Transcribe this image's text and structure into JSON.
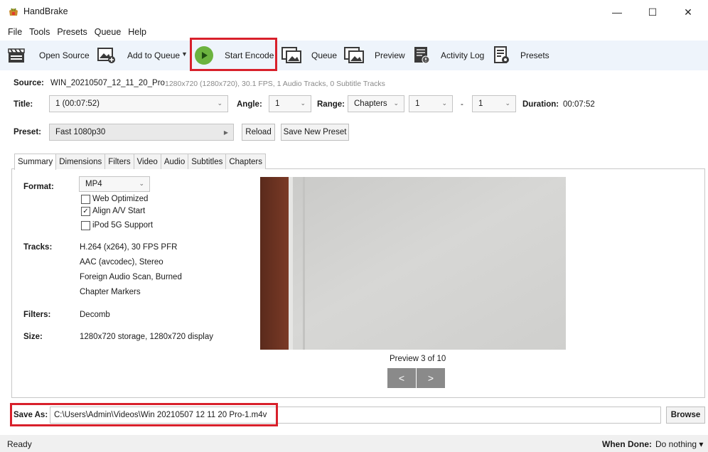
{
  "window": {
    "title": "HandBrake",
    "minimize": "—",
    "maximize": "☐",
    "close": "✕"
  },
  "menu": [
    "File",
    "Tools",
    "Presets",
    "Queue",
    "Help"
  ],
  "toolbar": {
    "open_source": "Open Source",
    "add_to_queue": "Add to Queue",
    "start_encode": "Start Encode",
    "queue": "Queue",
    "preview": "Preview",
    "activity_log": "Activity Log",
    "presets": "Presets"
  },
  "source": {
    "label": "Source:",
    "name": "WIN_20210507_12_11_20_Pro",
    "info": "1280x720 (1280x720), 30.1 FPS, 1 Audio Tracks, 0 Subtitle Tracks"
  },
  "title_row": {
    "title_label": "Title:",
    "title_value": "1  (00:07:52)",
    "angle_label": "Angle:",
    "angle_value": "1",
    "range_label": "Range:",
    "range_mode": "Chapters",
    "range_start": "1",
    "range_dash": "-",
    "range_end": "1",
    "duration_label": "Duration:",
    "duration_value": "00:07:52"
  },
  "preset_row": {
    "label": "Preset:",
    "value": "Fast 1080p30",
    "reload": "Reload",
    "save_new": "Save New Preset"
  },
  "tabs": [
    "Summary",
    "Dimensions",
    "Filters",
    "Video",
    "Audio",
    "Subtitles",
    "Chapters"
  ],
  "summary": {
    "format_label": "Format:",
    "format_value": "MP4",
    "web_optimized": "Web Optimized",
    "align_av": "Align A/V Start",
    "ipod": "iPod 5G Support",
    "web_optimized_checked": false,
    "align_av_checked": true,
    "ipod_checked": false,
    "tracks_label": "Tracks:",
    "tracks": [
      "H.264 (x264), 30 FPS PFR",
      "AAC (avcodec), Stereo",
      "Foreign Audio Scan, Burned",
      "Chapter Markers"
    ],
    "filters_label": "Filters:",
    "filters_value": "Decomb",
    "size_label": "Size:",
    "size_value": "1280x720 storage, 1280x720 display"
  },
  "preview": {
    "caption": "Preview 3 of 10",
    "prev": "<",
    "next": ">"
  },
  "save_as": {
    "label": "Save As:",
    "path": "C:\\Users\\Admin\\Videos\\Win 20210507 12 11 20 Pro-1.m4v",
    "browse": "Browse"
  },
  "status": {
    "text": "Ready",
    "when_done_label": "When Done:",
    "when_done_value": "Do nothing ▾"
  },
  "colors": {
    "highlight": "#d8202b",
    "toolbar_bg": "#eef4fb",
    "nav_button": "#8a8a8a"
  }
}
